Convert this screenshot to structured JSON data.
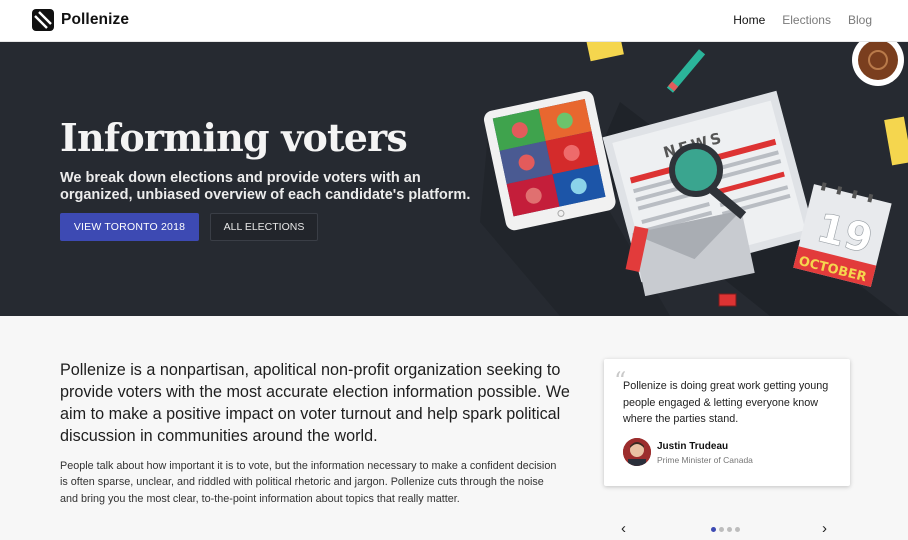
{
  "nav": {
    "brand": "Pollenize",
    "links": [
      {
        "label": "Home",
        "active": true
      },
      {
        "label": "Elections",
        "active": false
      },
      {
        "label": "Blog",
        "active": false
      }
    ]
  },
  "hero": {
    "title": "Informing voters",
    "subtitle": "We break down elections and provide voters with an organized, unbiased overview of each candidate's platform.",
    "primary_button": "VIEW TORONTO 2018",
    "secondary_button": "ALL ELECTIONS",
    "illustration": {
      "newspaper_label": "NEWS",
      "calendar_day": "19",
      "calendar_month": "OCTOBER"
    }
  },
  "about": {
    "lead": "Pollenize is a nonpartisan, apolitical non-profit organization seeking to provide voters with the most accurate election information possible. We aim to make a positive impact on voter turnout and help spark political discussion in communities around the world.",
    "body": "People talk about how important it is to vote, but the information necessary to make a confident decision is often sparse, unclear, and riddled with political rhetoric and jargon. Pollenize cuts through the noise and bring you the most clear, to-the-point information about topics that really matter."
  },
  "testimonial": {
    "quote": "Pollenize is doing great work getting young people engaged & letting everyone know where the parties stand.",
    "name": "Justin Trudeau",
    "role": "Prime Minister of Canada",
    "active_slide": 1,
    "slide_count": 4
  },
  "colors": {
    "accent": "#3d4ab3",
    "hero_bg": "#262a31",
    "page_bg": "#f7f7f7"
  },
  "icons": {
    "brand_logo": "pollenize-logo-icon",
    "prev": "chevron-left-icon",
    "next": "chevron-right-icon"
  }
}
